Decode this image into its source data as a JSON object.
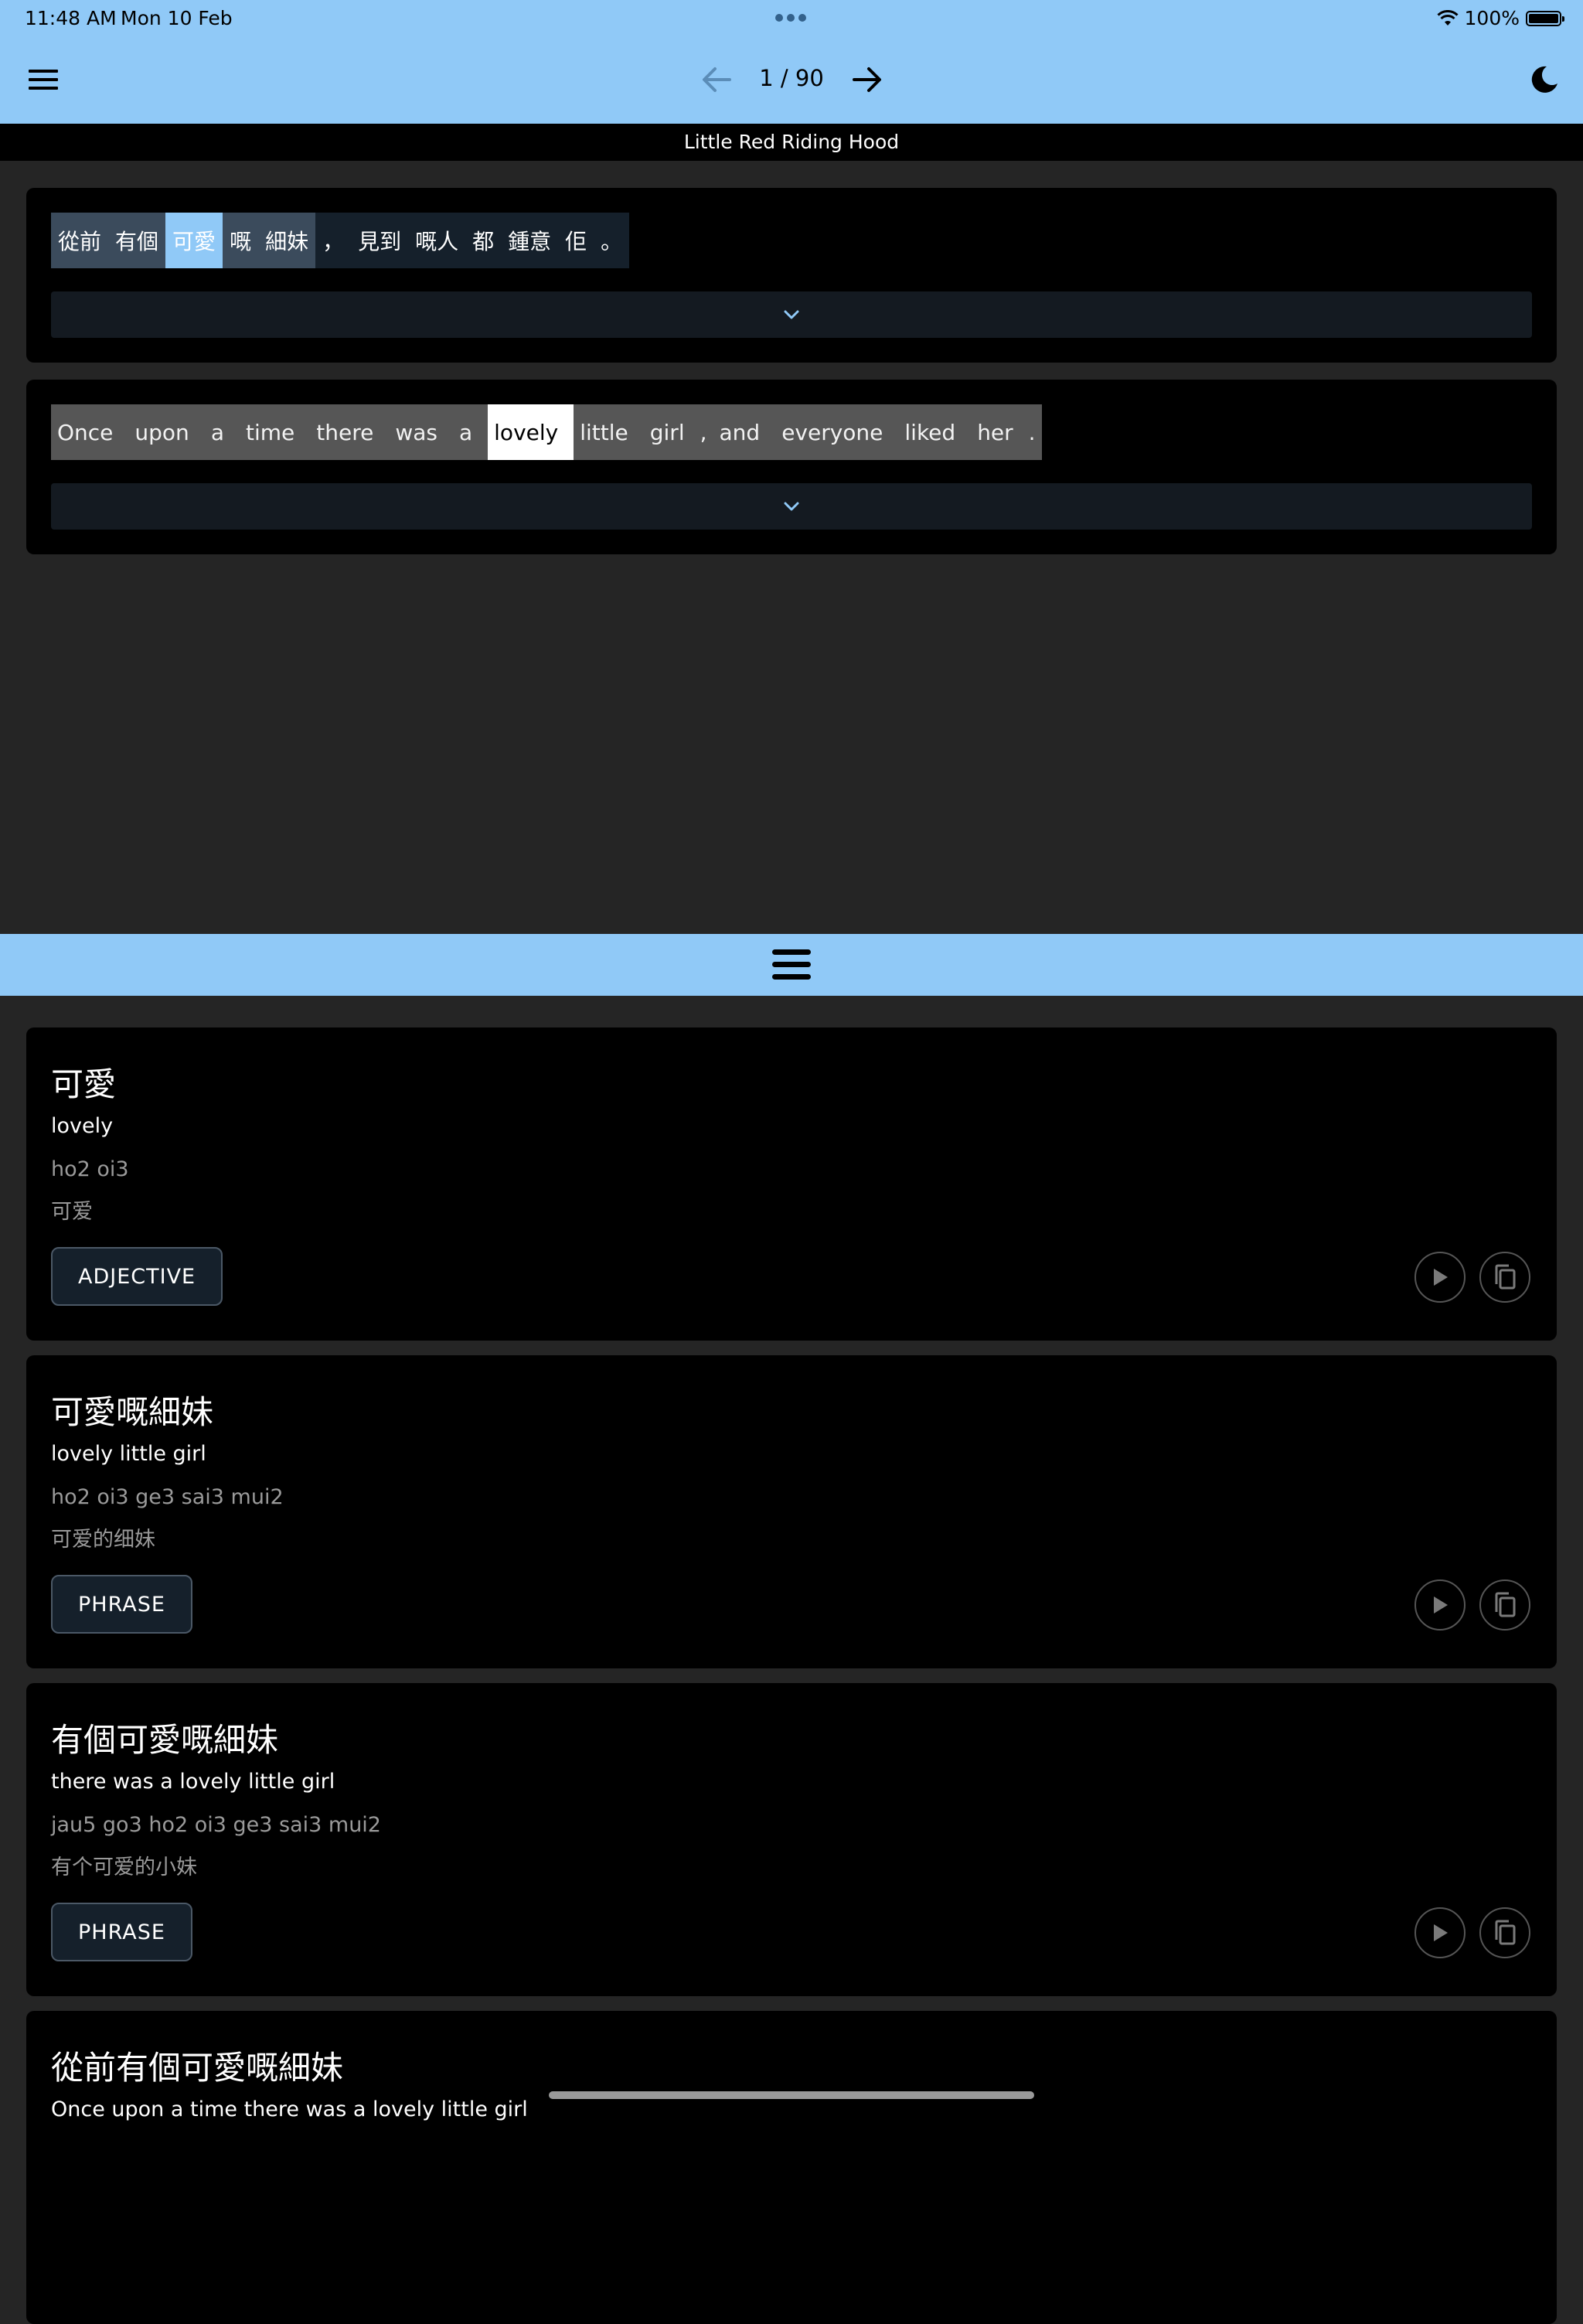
{
  "status_bar": {
    "time": "11:48 AM",
    "date": "Mon 10 Feb",
    "battery": "100%"
  },
  "app_bar": {
    "page_counter": "1 / 90"
  },
  "story_title": "Little Red Riding Hood",
  "sentence_cantonese": {
    "tokens": [
      "從前",
      "有個",
      "可愛",
      "嘅",
      "細妹",
      "，",
      "見到",
      "嘅人",
      "都",
      "鍾意",
      "佢",
      "。"
    ]
  },
  "sentence_english": {
    "tokens": [
      "Once",
      "upon",
      "a",
      "time",
      "there",
      "was",
      "a",
      "lovely",
      "little",
      "girl",
      ",",
      "and",
      "everyone",
      "liked",
      "her",
      "."
    ]
  },
  "word_cards": [
    {
      "headword": "可愛",
      "meaning": "lovely",
      "romanization": "ho2 oi3",
      "simplified": "可爱",
      "pos": "ADJECTIVE"
    },
    {
      "headword": "可愛嘅細妹",
      "meaning": "lovely little girl",
      "romanization": "ho2 oi3 ge3 sai3 mui2",
      "simplified": "可爱的细妹",
      "pos": "PHRASE"
    },
    {
      "headword": "有個可愛嘅細妹",
      "meaning": "there was a lovely little girl",
      "romanization": "jau5 go3 ho2 oi3 ge3 sai3 mui2",
      "simplified": "有个可爱的小妹",
      "pos": "PHRASE"
    },
    {
      "headword": "從前有個可愛嘅細妹",
      "meaning": "Once upon a time there was a lovely little girl"
    }
  ],
  "colors": {
    "accent": "#90c9f7",
    "background": "#252525",
    "card": "#000000"
  }
}
